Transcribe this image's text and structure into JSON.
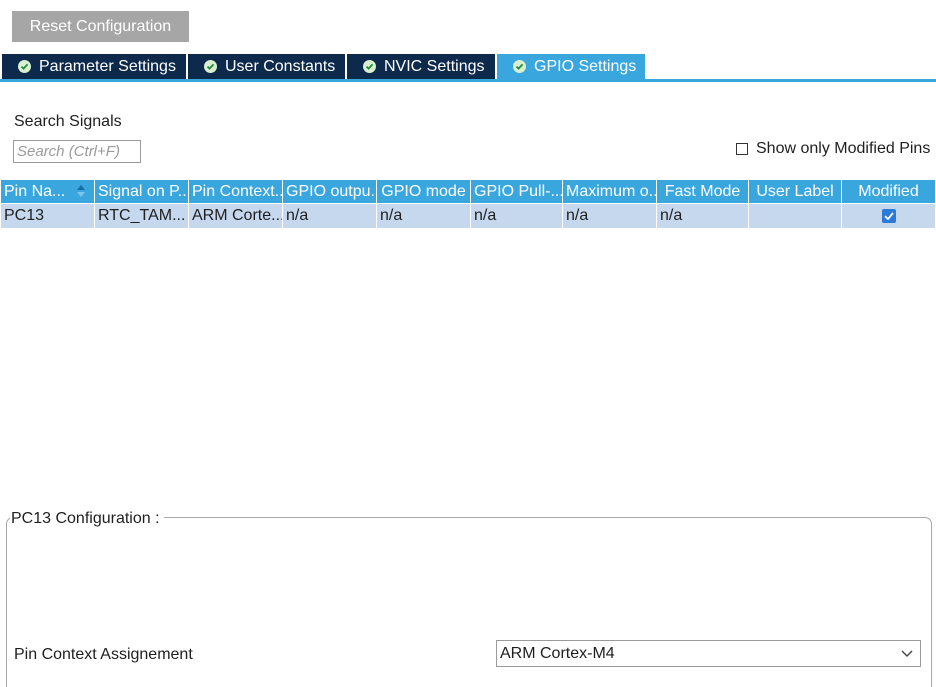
{
  "toolbar": {
    "reset_label": "Reset Configuration"
  },
  "tabs": [
    {
      "label": "Parameter Settings",
      "active": false
    },
    {
      "label": "User Constants",
      "active": false
    },
    {
      "label": "NVIC Settings",
      "active": false
    },
    {
      "label": "GPIO Settings",
      "active": true
    }
  ],
  "search": {
    "label": "Search Signals",
    "placeholder": "Search (Ctrl+F)",
    "value": ""
  },
  "filter": {
    "label": "Show only Modified Pins",
    "checked": false
  },
  "table": {
    "headers": [
      "Pin Na...",
      "Signal on P...",
      "Pin Context...",
      "GPIO outpu...",
      "GPIO mode",
      "GPIO Pull-...",
      "Maximum o...",
      "Fast Mode",
      "User Label",
      "Modified"
    ],
    "rows": [
      {
        "cells": [
          "PC13",
          "RTC_TAM...",
          "ARM Corte...",
          "n/a",
          "n/a",
          "n/a",
          "n/a",
          "n/a",
          ""
        ],
        "modified": true
      }
    ]
  },
  "config": {
    "title": "PC13 Configuration :",
    "pin_context_label": "Pin Context Assignement",
    "pin_context_value": "ARM Cortex-M4"
  },
  "colors": {
    "tab_dark": "#0d2a4d",
    "accent": "#39a7de",
    "row_selected": "#c5d8ee",
    "button_gray": "#a6a6a6"
  }
}
